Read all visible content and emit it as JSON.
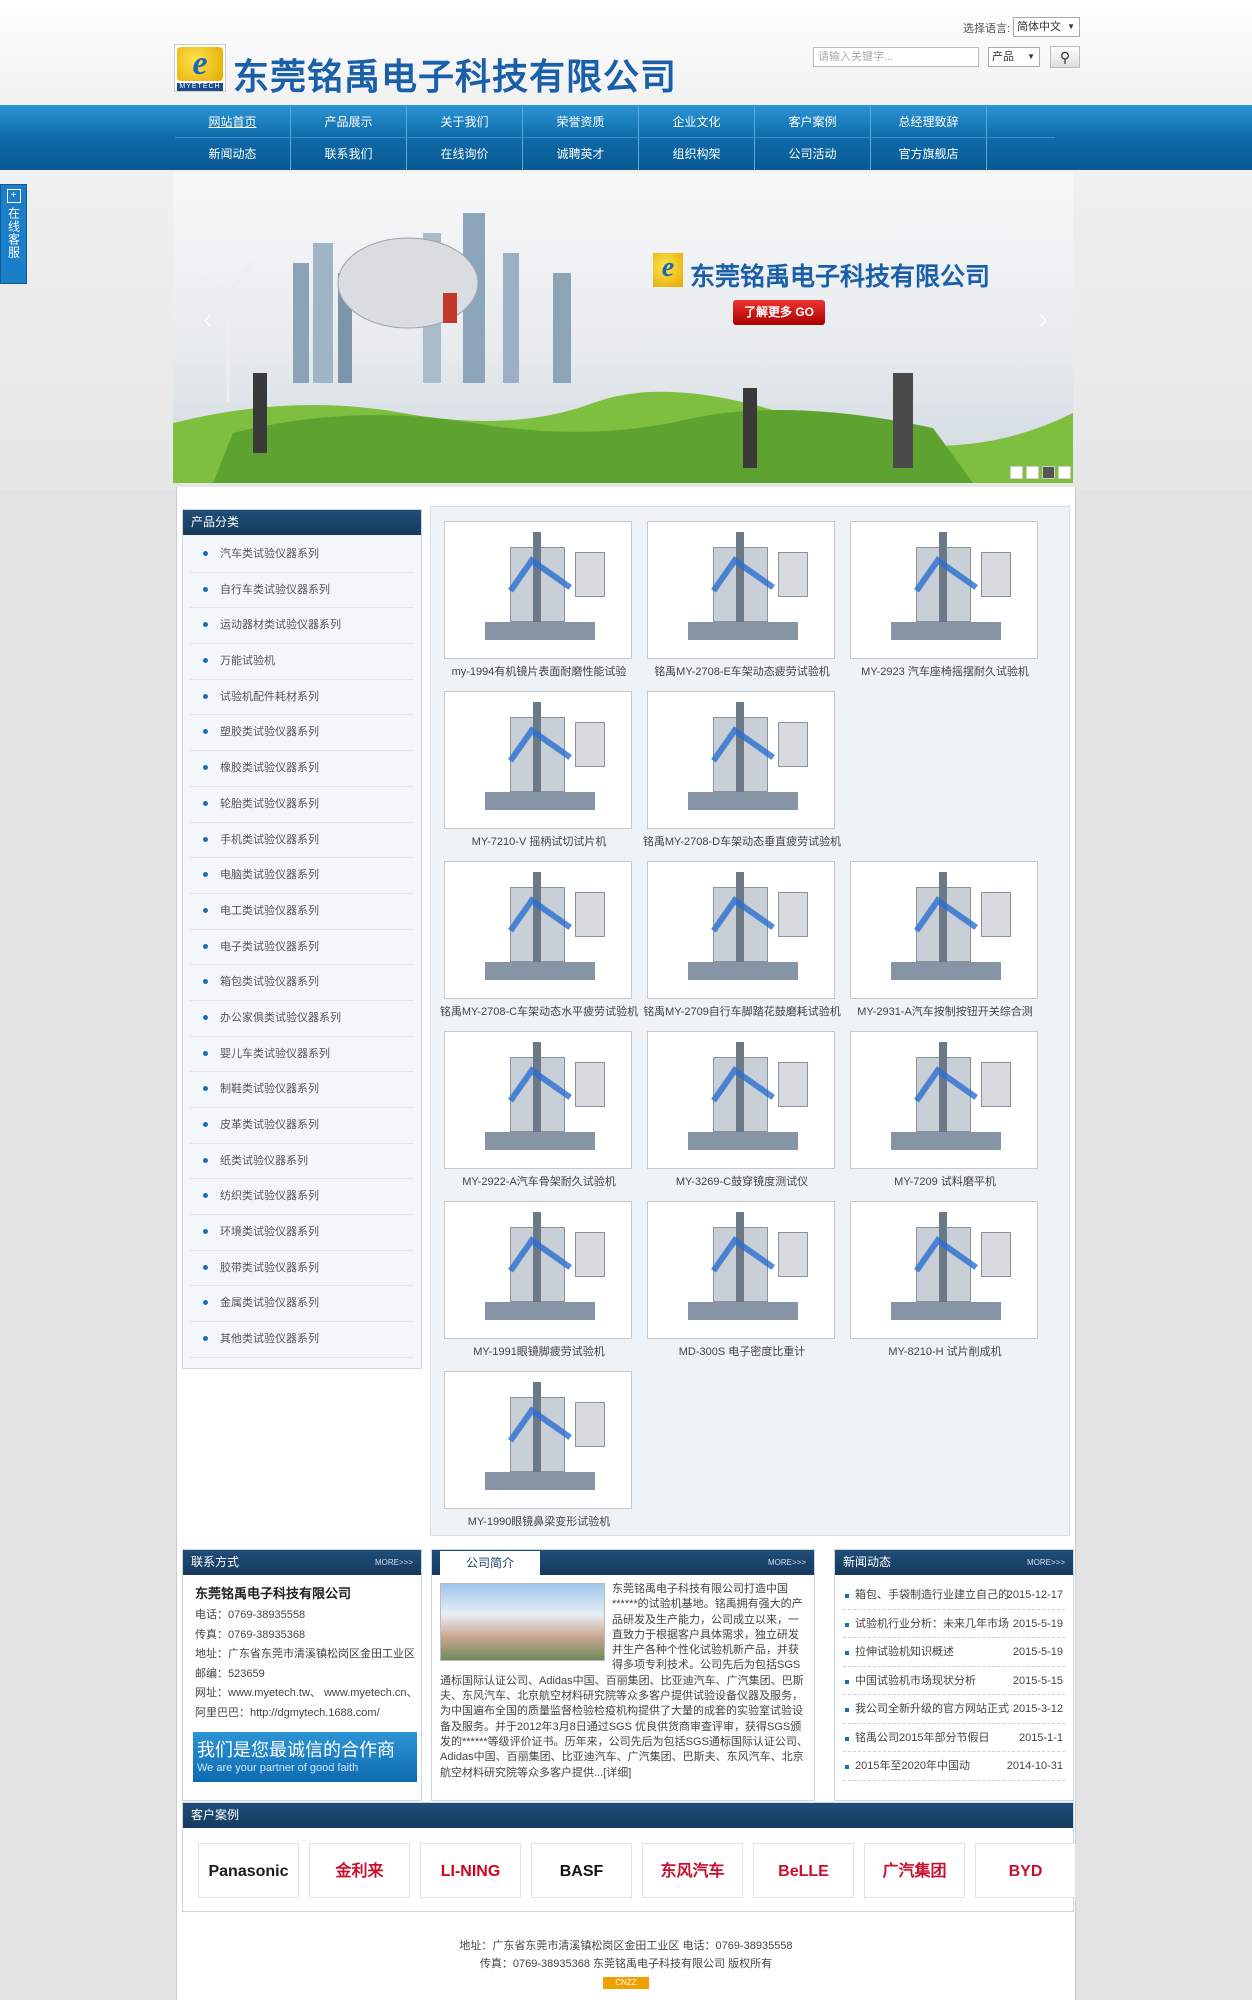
{
  "header": {
    "company_name": "东莞铭禹电子科技有限公司",
    "logo_letter": "e",
    "logo_sub": "MYETECH",
    "lang_label": "选择语言:",
    "lang_value": "简体中文",
    "search_placeholder": "请输入关键字...",
    "search_category": "产品",
    "search_icon": "magnifier-icon"
  },
  "nav": {
    "row1": [
      "网站首页",
      "产品展示",
      "关于我们",
      "荣誉资质",
      "企业文化",
      "客户案例",
      "总经理致辞"
    ],
    "row2": [
      "新闻动态",
      "联系我们",
      "在线询价",
      "诚聘英才",
      "组织构架",
      "公司活动",
      "官方旗舰店"
    ]
  },
  "banner": {
    "title": "东莞铭禹电子科技有限公司",
    "button": "了解更多 GO",
    "prev": "‹",
    "next": "›"
  },
  "side_service": {
    "label": "在线客服",
    "icon": "plus"
  },
  "categories": {
    "title": "产品分类",
    "items": [
      "汽车类试验仪器系列",
      "自行车类试验仪器系列",
      "运动器材类试验仪器系列",
      "万能试验机",
      "试验机配件耗材系列",
      "塑胶类试验仪器系列",
      "橡胶类试验仪器系列",
      "轮胎类试验仪器系列",
      "手机类试验仪器系列",
      "电脑类试验仪器系列",
      "电工类试验仪器系列",
      "电子类试验仪器系列",
      "箱包类试验仪器系列",
      "办公家俱类试验仪器系列",
      "婴儿车类试验仪器系列",
      "制鞋类试验仪器系列",
      "皮革类试验仪器系列",
      "纸类试验仪器系列",
      "纺织类试验仪器系列",
      "环境类试验仪器系列",
      "胶带类试验仪器系列",
      "金属类试验仪器系列",
      "其他类试验仪器系列"
    ]
  },
  "products": [
    "my-1994有机镜片表面耐磨性能试验",
    "铭禹MY-2708-E车架动态疲劳试验机",
    "MY-2923 汽车座椅摇摆耐久试验机",
    "MY-7210-V 摇柄试切试片机",
    "铭禹MY-2708-D车架动态垂直疲劳试验机",
    "铭禹MY-2708-C车架动态水平疲劳试验机",
    "铭禹MY-2709自行车脚踏花鼓磨耗试验机",
    "MY-2931-A汽车按制按钮开关综合测",
    "MY-2922-A汽车骨架耐久试验机",
    "MY-3269-C鼓穿镜度测试仪",
    "MY-7209 试料磨平机",
    "MY-1991眼镜脚疲劳试验机",
    "MD-300S 电子密度比重计",
    "MY-8210-H 试片削成机",
    "MY-1990眼镜鼻梁变形试验机"
  ],
  "contact": {
    "title": "联系方式",
    "more": "MORE>>>",
    "company": "东莞铭禹电子科技有限公司",
    "lines": [
      "电话：0769-38935558",
      "传真：0769-38935368",
      "地址：广东省东莞市清溪镇松岗区金田工业区",
      "邮编：523659",
      "网址：www.myetech.tw、 www.myetech.cn、",
      "阿里巴巴：http://dgmytech.1688.com/"
    ],
    "banner_cn": "我们是您最诚信的合作商",
    "banner_en": "We are your partner of good faith"
  },
  "about": {
    "title": "公司简介",
    "more": "MORE>>>",
    "text": "东莞铭禹电子科技有限公司打造中国******的试验机基地。铭禹拥有强大的产品研发及生产能力，公司成立以来，一直致力于根据客户具体需求，独立研发并生产各种个性化试验机新产品，并获得多项专利技术。公司先后为包括SGS 通标国际认证公司、Adidas中国、百丽集团、比亚迪汽车、广汽集团、巴斯夫、东风汽车、北京航空材料研究院等众多客户提供试验设备仪器及服务，为中国遍布全国的质量监督检验检疫机构提供了大量的成套的实验室试验设备及服务。并于2012年3月8日通过SGS 优良供货商审查评审，获得SGS颁发的******等级评价证书。历年来，公司先后为包括SGS通标国际认证公司、Adidas中国、百丽集团、比亚迪汽车、广汽集团、巴斯夫、东风汽车、北京航空材料研究院等众多客户提供...",
    "link": "[详细]"
  },
  "news": {
    "title": "新闻动态",
    "more": "MORE>>>",
    "items": [
      {
        "title": "箱包、手袋制造行业建立自己的",
        "date": "2015-12-17"
      },
      {
        "title": "试验机行业分析：未来几年市场",
        "date": "2015-5-19"
      },
      {
        "title": "拉伸试验机知识概述",
        "date": "2015-5-19"
      },
      {
        "title": "中国试验机市场现状分析",
        "date": "2015-5-15"
      },
      {
        "title": "我公司全新升级的官方网站正式",
        "date": "2015-3-12"
      },
      {
        "title": "铭禹公司2015年部分节假日",
        "date": "2015-1-1"
      },
      {
        "title": "2015年至2020年中国动",
        "date": "2014-10-31"
      }
    ]
  },
  "clients": {
    "title": "客户案例",
    "logos": [
      {
        "name": "Panasonic",
        "color": "#1a1a1a"
      },
      {
        "name": "金利来",
        "color": "#c8102e"
      },
      {
        "name": "LI-NING",
        "color": "#d0021b"
      },
      {
        "name": "BASF",
        "color": "#111111"
      },
      {
        "name": "东风汽车",
        "color": "#c8102e"
      },
      {
        "name": "BeLLE",
        "color": "#c8102e"
      },
      {
        "name": "广汽集团",
        "color": "#c8102e"
      },
      {
        "name": "BYD",
        "color": "#c8102e"
      }
    ]
  },
  "footer": {
    "line1": "地址：广东省东莞市清溪镇松岗区金田工业区 电话：0769-38935558",
    "line2": "传真：0769-38935368    东莞铭禹电子科技有限公司 版权所有",
    "badge": "CNZZ"
  }
}
